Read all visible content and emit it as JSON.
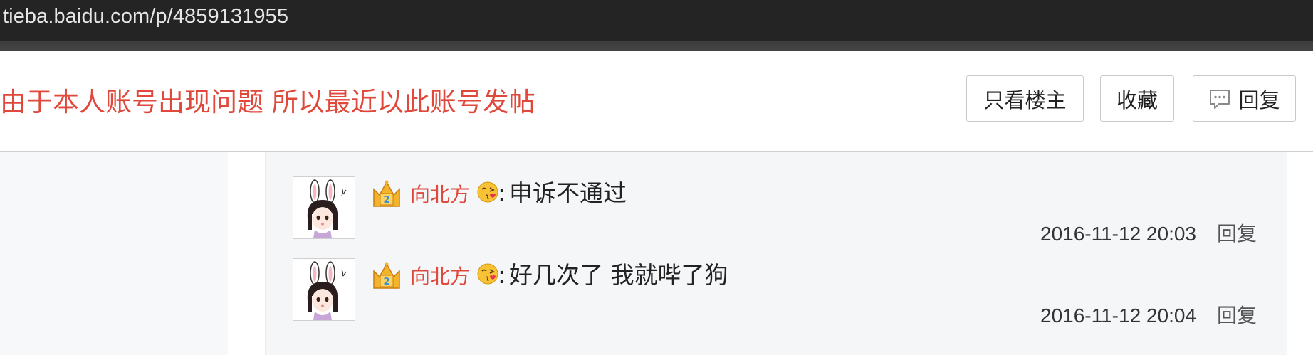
{
  "browser": {
    "url": "tieba.baidu.com/p/4859131955"
  },
  "header": {
    "title": "由于本人账号出现问题 所以最近以此账号发帖",
    "buttons": {
      "only_op": "只看楼主",
      "favorite": "收藏",
      "reply": "回复"
    },
    "reply_icon": "comment-bubble-icon"
  },
  "comments": [
    {
      "username": "向北方",
      "colon": ":",
      "text": "申诉不通过",
      "time": "2016-11-12 20:03",
      "reply_label": "回复",
      "badge_icon": "member-crown-badge-icon",
      "emoji_icon": "kiss-emoji-icon"
    },
    {
      "username": "向北方",
      "colon": ":",
      "text": "好几次了 我就哔了狗",
      "time": "2016-11-12 20:04",
      "reply_label": "回复",
      "badge_icon": "member-crown-badge-icon",
      "emoji_icon": "kiss-emoji-icon"
    }
  ],
  "colors": {
    "title_red": "#e0483b",
    "username_red": "#e0483b",
    "url_bar_bg": "#242424",
    "comment_panel_bg": "#f5f6f8"
  }
}
